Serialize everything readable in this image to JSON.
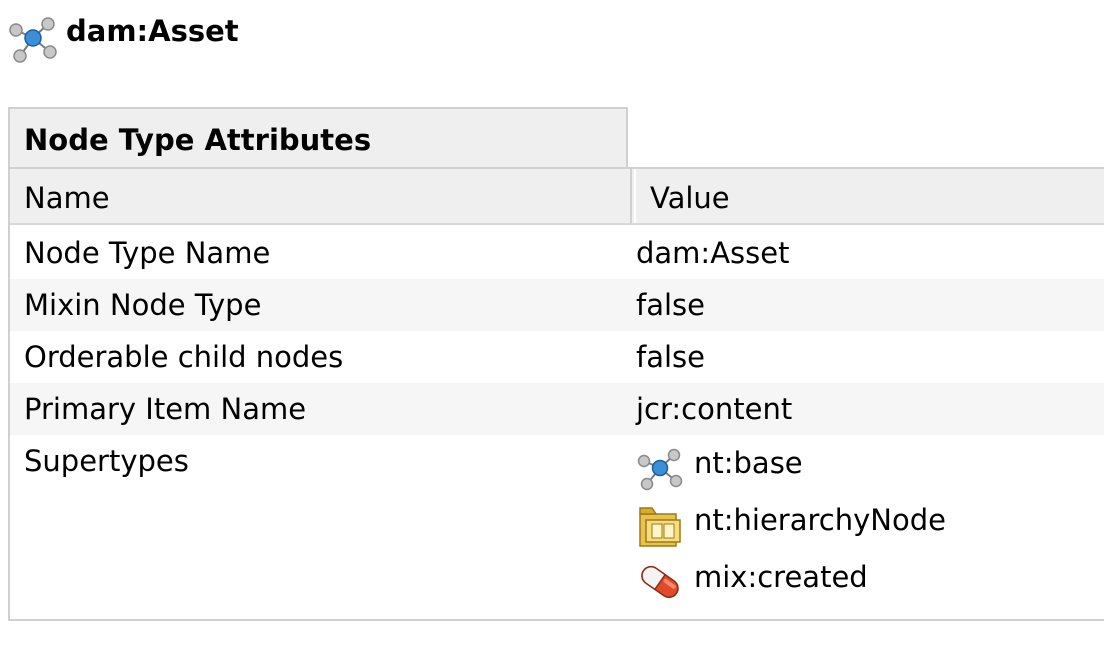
{
  "header": {
    "title": "dam:Asset",
    "icon": "node-type-icon"
  },
  "table": {
    "caption": "Node Type Attributes",
    "columns": {
      "name": "Name",
      "value": "Value"
    },
    "rows": [
      {
        "name": "Node Type Name",
        "value": "dam:Asset"
      },
      {
        "name": "Mixin Node Type",
        "value": "false"
      },
      {
        "name": "Orderable child nodes",
        "value": "false"
      },
      {
        "name": "Primary Item Name",
        "value": "jcr:content"
      }
    ],
    "supertypes": {
      "label": "Supertypes",
      "items": [
        {
          "name": "nt:base",
          "icon": "node-type-icon"
        },
        {
          "name": "nt:hierarchyNode",
          "icon": "folder-icon"
        },
        {
          "name": "mix:created",
          "icon": "mixin-pill-icon"
        }
      ]
    }
  },
  "colors": {
    "header_background": "#efefef",
    "alt_row_background": "#f6f6f6",
    "border": "#d0d0d0"
  }
}
